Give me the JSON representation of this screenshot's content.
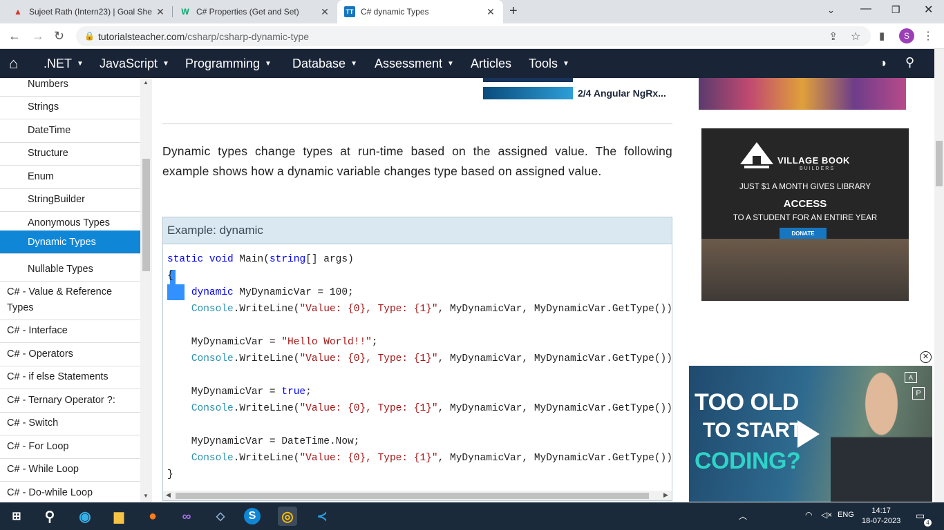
{
  "browser": {
    "tabs": [
      {
        "title": "Sujeet Rath (Intern23) | Goal She",
        "favicon": "pdf-icon",
        "active": false
      },
      {
        "title": "C# Properties (Get and Set)",
        "favicon": "w3schools-icon",
        "active": false
      },
      {
        "title": "C# dynamic Types",
        "favicon": "tutorialsteacher-icon",
        "active": true
      }
    ],
    "url_domain": "tutorialsteacher.com",
    "url_path": "/csharp/csharp-dynamic-type",
    "avatar_letter": "S"
  },
  "sitenav": {
    "items": [
      {
        "label": ".NET",
        "dropdown": true
      },
      {
        "label": "JavaScript",
        "dropdown": true
      },
      {
        "label": "Programming",
        "dropdown": true
      },
      {
        "label": "Database",
        "dropdown": true
      },
      {
        "label": "Assessment",
        "dropdown": true
      },
      {
        "label": "Articles",
        "dropdown": false
      },
      {
        "label": "Tools",
        "dropdown": true
      }
    ]
  },
  "sidebar": {
    "items": [
      {
        "label": "Numbers",
        "sub": true
      },
      {
        "label": "Strings",
        "sub": true
      },
      {
        "label": "DateTime",
        "sub": true
      },
      {
        "label": "Structure",
        "sub": true
      },
      {
        "label": "Enum",
        "sub": true
      },
      {
        "label": "StringBuilder",
        "sub": true
      },
      {
        "label": "Anonymous Types",
        "sub": true
      },
      {
        "label": "Dynamic Types",
        "sub": true,
        "active": true
      },
      {
        "label": "Nullable Types",
        "sub": true
      },
      {
        "label": "C# - Value & Reference Types",
        "sub": false
      },
      {
        "label": "C# - Interface",
        "sub": false
      },
      {
        "label": "C# - Operators",
        "sub": false
      },
      {
        "label": "C# - if else Statements",
        "sub": false
      },
      {
        "label": "C# - Ternary Operator ?:",
        "sub": false
      },
      {
        "label": "C# - Switch",
        "sub": false
      },
      {
        "label": "C# - For Loop",
        "sub": false
      },
      {
        "label": "C# - While Loop",
        "sub": false
      },
      {
        "label": "C# - Do-while Loop",
        "sub": false
      }
    ]
  },
  "main": {
    "intro": "Dynamic types change types at run-time based on the assigned value. The following example shows how a dynamic variable changes type based on assigned value.",
    "example_title": "Example: dynamic"
  },
  "ads": {
    "course_title": "2/4 Angular NgRx...",
    "vbb_brand": "VILLAGE BOOK",
    "vbb_brand2": "BUILDERS",
    "vbb_line1": "JUST $1 A MONTH GIVES LIBRARY",
    "vbb_line2": "ACCESS",
    "vbb_line3": "TO A STUDENT FOR AN ENTIRE YEAR",
    "vbb_donate": "DONATE"
  },
  "video": {
    "line1": "TOO OLD",
    "line2": "TO START",
    "line3": "CODING?"
  },
  "taskbar": {
    "time": "14:17",
    "date": "18-07-2023",
    "lang": "ENG",
    "notifications": "4"
  }
}
